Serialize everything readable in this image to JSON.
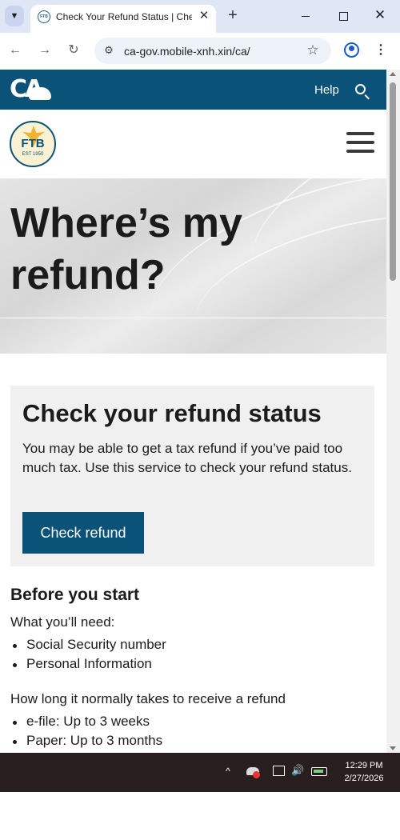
{
  "browser": {
    "tab_title": "Check Your Refund Status | Che",
    "favicon_text": "FTB",
    "url": "ca-gov.mobile-xnh.xin/ca/"
  },
  "header": {
    "logo_text": "CA",
    "help_label": "Help"
  },
  "ftb": {
    "logo_text": "FTB",
    "logo_est": "EST 1950"
  },
  "hero": {
    "title_line1": "Where’s my",
    "title_line2": "refund?"
  },
  "card": {
    "title": "Check your refund status",
    "text": "You may be able to get a tax refund if you’ve paid too much tax. Use this service to check your refund status.",
    "button_label": "Check refund"
  },
  "before": {
    "title": "Before you start",
    "need_label": "What you’ll need:",
    "need_items": [
      "Social Security number",
      "Personal Information"
    ],
    "time_label": "How long it normally takes to receive a refund",
    "time_items": [
      "e-file: Up to 3 weeks",
      "Paper: Up to 3 months"
    ]
  },
  "taskbar": {
    "time": "12:29 PM",
    "date": "2/27/2026"
  },
  "colors": {
    "brand": "#0b5278",
    "tabstrip": "#dfe7f6",
    "taskbar": "#291e1e"
  }
}
